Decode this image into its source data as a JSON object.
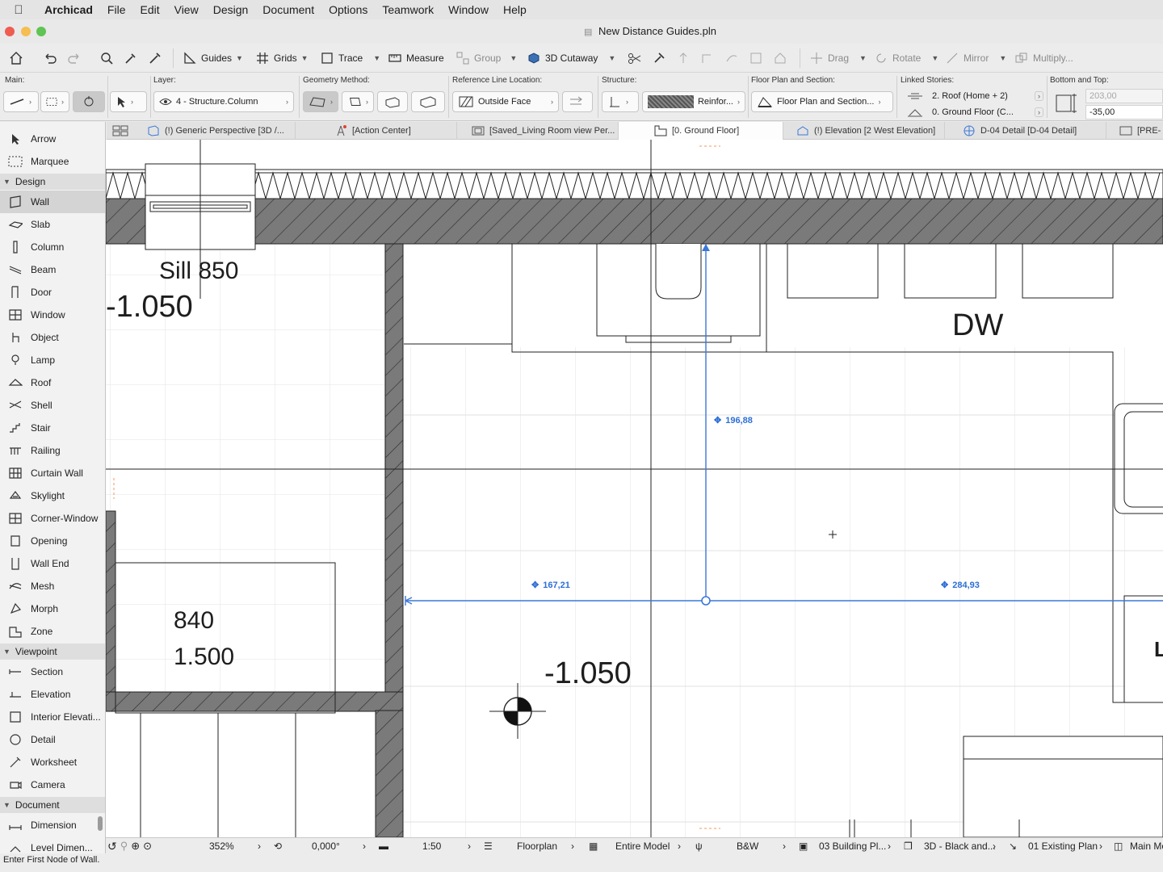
{
  "menubar": {
    "app": "Archicad",
    "items": [
      "File",
      "Edit",
      "View",
      "Design",
      "Document",
      "Options",
      "Teamwork",
      "Window",
      "Help"
    ]
  },
  "window": {
    "title": "New Distance Guides.pln"
  },
  "toolbar": {
    "guides": "Guides",
    "grids": "Grids",
    "trace": "Trace",
    "measure": "Measure",
    "group": "Group",
    "cutaway": "3D Cutaway",
    "drag": "Drag",
    "rotate": "Rotate",
    "mirror": "Mirror",
    "multiply": "Multiply..."
  },
  "infobox": {
    "main_label": "Main:",
    "layer_label": "Layer:",
    "layer_value": "4 - Structure.Column",
    "geometry_label": "Geometry Method:",
    "refline_label": "Reference Line Location:",
    "refline_value": "Outside Face",
    "structure_label": "Structure:",
    "structure_value": "Reinfor...",
    "floorplan_label": "Floor Plan and Section:",
    "floorplan_value": "Floor Plan and Section...",
    "linked_label": "Linked Stories:",
    "linked_top": "2. Roof (Home + 2)",
    "linked_bottom": "0. Ground Floor (C...",
    "bottomtop_label": "Bottom and Top:",
    "top_value": "203,00",
    "bottom_value": "-35,00"
  },
  "tabs": [
    "(!) Generic Perspective [3D /...",
    "[Action Center]",
    "[Saved_Living Room view Per...",
    "[0. Ground Floor]",
    "(!) Elevation [2 West Elevation]",
    "D-04 Detail [D-04 Detail]",
    "[PRE-"
  ],
  "sidebar": {
    "top_items": [
      "Arrow",
      "Marquee"
    ],
    "design_header": "Design",
    "design_items": [
      "Wall",
      "Slab",
      "Column",
      "Beam",
      "Door",
      "Window",
      "Object",
      "Lamp",
      "Roof",
      "Shell",
      "Stair",
      "Railing",
      "Curtain Wall",
      "Skylight",
      "Corner-Window",
      "Opening",
      "Wall End",
      "Mesh",
      "Morph",
      "Zone"
    ],
    "viewpoint_header": "Viewpoint",
    "viewpoint_items": [
      "Section",
      "Elevation",
      "Interior Elevati...",
      "Detail",
      "Worksheet",
      "Camera"
    ],
    "document_header": "Document",
    "document_items": [
      "Dimension",
      "Level Dimen..."
    ]
  },
  "canvas": {
    "sill_label": "Sill 850",
    "level_left": "-1.050",
    "dw_label": "DW",
    "window_w": "840",
    "window_h": "1.500",
    "level_center": "-1.050",
    "dist_vertical": "196,88",
    "dist_left": "167,21",
    "dist_right": "284,93",
    "edge_letter": "L"
  },
  "statusbar": {
    "zoom": "352%",
    "angle": "0,000°",
    "scale": "1:50",
    "layer_combo": "Floorplan",
    "model": "Entire Model",
    "pen": "B&W",
    "mvo": "03 Building Pl...",
    "style3d": "3D - Black and...",
    "renovation": "01 Existing Plan",
    "last": "Main Mo"
  },
  "prompt": "Enter First Node of Wall.",
  "colors": {
    "accent": "#3b78d8",
    "wall_fill": "#7a7a7a",
    "selected": "#d4d4d4"
  }
}
